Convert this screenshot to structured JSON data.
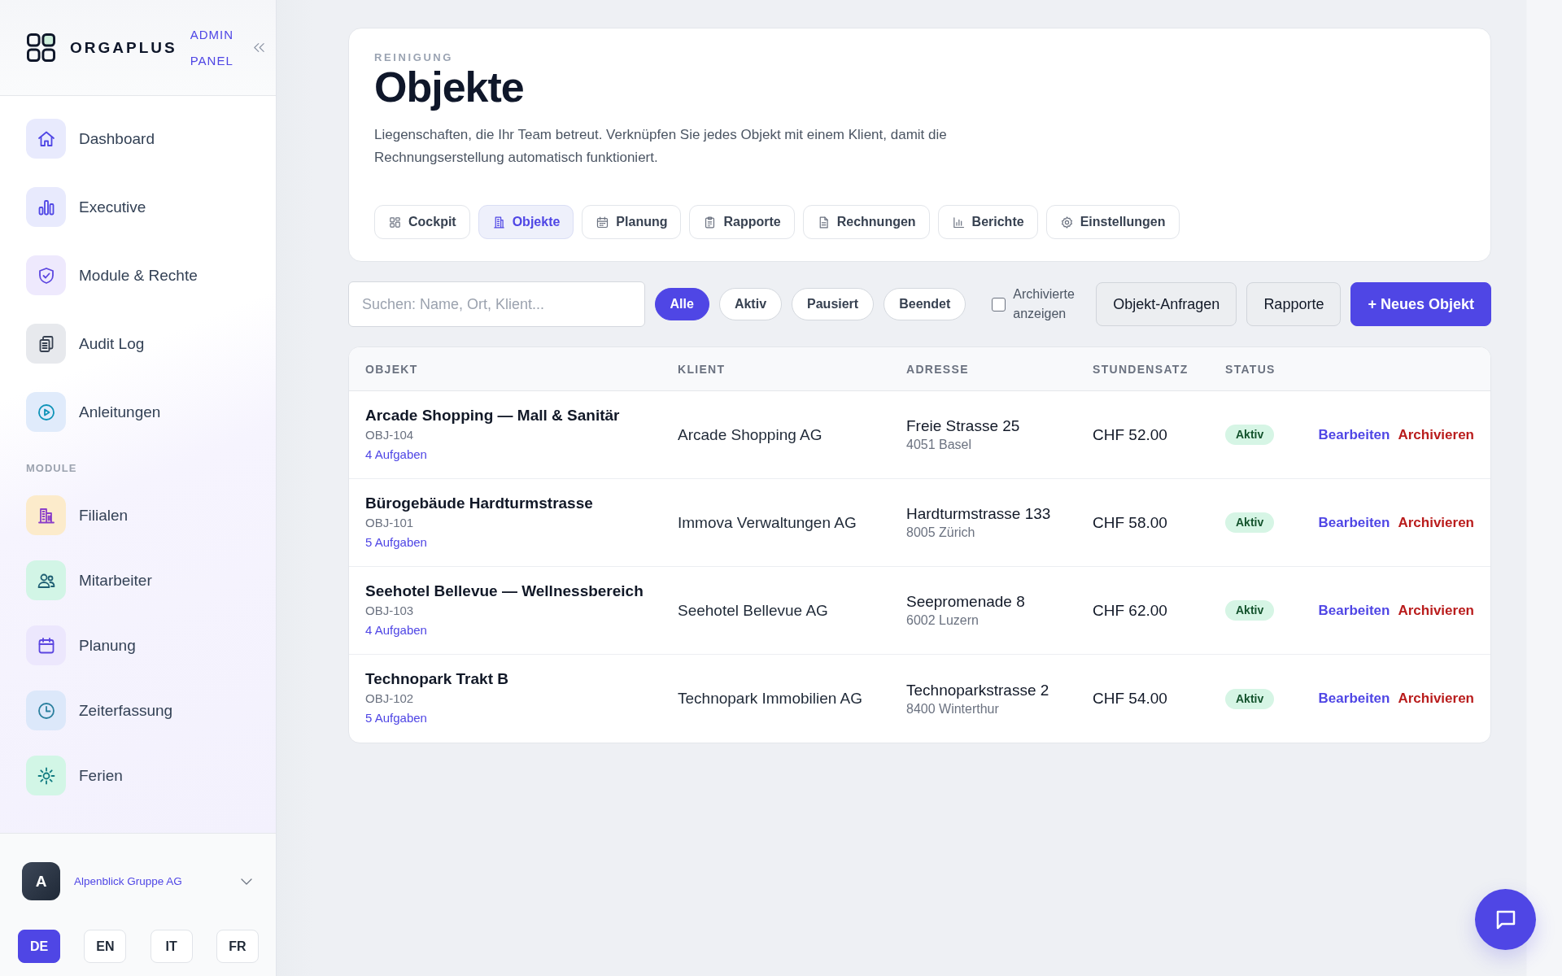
{
  "sidebar": {
    "brand": {
      "name": "ORGAPLUS",
      "subtitle": "ADMIN PANEL"
    },
    "nav": [
      {
        "items": [
          {
            "label": "Dashboard",
            "selected": false
          },
          {
            "label": "Executive",
            "selected": false
          },
          {
            "label": "Module & Rechte",
            "selected": false
          },
          {
            "label": "Audit Log",
            "selected": false
          },
          {
            "label": "Anleitungen",
            "selected": false
          }
        ]
      },
      {
        "title": "MODULE",
        "items": [
          {
            "label": "Filialen",
            "selected": false
          },
          {
            "label": "Mitarbeiter",
            "selected": false
          },
          {
            "label": "Planung",
            "selected": false
          },
          {
            "label": "Zeiterfassung",
            "selected": false
          },
          {
            "label": "Ferien",
            "selected": false
          }
        ]
      }
    ],
    "account": {
      "initial": "A",
      "name": "Alpenblick Gruppe AG"
    },
    "languages": [
      {
        "label": "DE",
        "selected": true
      },
      {
        "label": "EN",
        "selected": false
      },
      {
        "label": "IT",
        "selected": false
      },
      {
        "label": "FR",
        "selected": false
      }
    ]
  },
  "header": {
    "eyebrow": "REINIGUNG",
    "title": "Objekte",
    "description": "Liegenschaften, die Ihr Team betreut. Verknüpfen Sie jedes Objekt mit einem Klient, damit die Rechnungserstellung automatisch funktioniert.",
    "tabs": [
      {
        "label": "Cockpit",
        "selected": false
      },
      {
        "label": "Objekte",
        "selected": true
      },
      {
        "label": "Planung",
        "selected": false
      },
      {
        "label": "Rapporte",
        "selected": false
      },
      {
        "label": "Rechnungen",
        "selected": false
      },
      {
        "label": "Berichte",
        "selected": false
      },
      {
        "label": "Einstellungen",
        "selected": false
      }
    ]
  },
  "toolbar": {
    "search": {
      "placeholder": "Suchen: Name, Ort, Klient..."
    },
    "filters": [
      {
        "label": "Alle",
        "selected": true
      },
      {
        "label": "Aktiv",
        "selected": false
      },
      {
        "label": "Pausiert",
        "selected": false
      },
      {
        "label": "Beendet",
        "selected": false
      }
    ],
    "archived_toggle": {
      "label": "Archivierte anzeigen",
      "checked": false
    },
    "buttons": [
      {
        "label": "Objekt-Anfragen",
        "kind": "secondary"
      },
      {
        "label": "Rapporte",
        "kind": "secondary"
      },
      {
        "label": "+ Neues Objekt",
        "kind": "primary"
      }
    ]
  },
  "table": {
    "columns": [
      "OBJEKT",
      "KLIENT",
      "ADRESSE",
      "STUNDENSATZ",
      "STATUS"
    ],
    "rows": [
      {
        "name": "Arcade Shopping — Mall & Sanitär",
        "code": "OBJ-104",
        "tasks": "4 Aufgaben",
        "client": "Arcade Shopping AG",
        "street": "Freie Strasse 25",
        "city": "4051 Basel",
        "rate": "CHF 52.00",
        "status": "Aktiv",
        "actions": [
          {
            "label": "Bearbeiten",
            "kind": "edit"
          },
          {
            "label": "Archivieren",
            "kind": "archive"
          }
        ]
      },
      {
        "name": "Bürogebäude Hardturmstrasse",
        "code": "OBJ-101",
        "tasks": "5 Aufgaben",
        "client": "Immova Verwaltungen AG",
        "street": "Hardturmstrasse 133",
        "city": "8005 Zürich",
        "rate": "CHF 58.00",
        "status": "Aktiv",
        "actions": [
          {
            "label": "Bearbeiten",
            "kind": "edit"
          },
          {
            "label": "Archivieren",
            "kind": "archive"
          }
        ]
      },
      {
        "name": "Seehotel Bellevue — Wellnessbereich",
        "code": "OBJ-103",
        "tasks": "4 Aufgaben",
        "client": "Seehotel Bellevue AG",
        "street": "Seepromenade 8",
        "city": "6002 Luzern",
        "rate": "CHF 62.00",
        "status": "Aktiv",
        "actions": [
          {
            "label": "Bearbeiten",
            "kind": "edit"
          },
          {
            "label": "Archivieren",
            "kind": "archive"
          }
        ]
      },
      {
        "name": "Technopark Trakt B",
        "code": "OBJ-102",
        "tasks": "5 Aufgaben",
        "client": "Technopark Immobilien AG",
        "street": "Technoparkstrasse 2",
        "city": "8400 Winterthur",
        "rate": "CHF 54.00",
        "status": "Aktiv",
        "actions": [
          {
            "label": "Bearbeiten",
            "kind": "edit"
          },
          {
            "label": "Archivieren",
            "kind": "archive"
          }
        ]
      }
    ]
  }
}
